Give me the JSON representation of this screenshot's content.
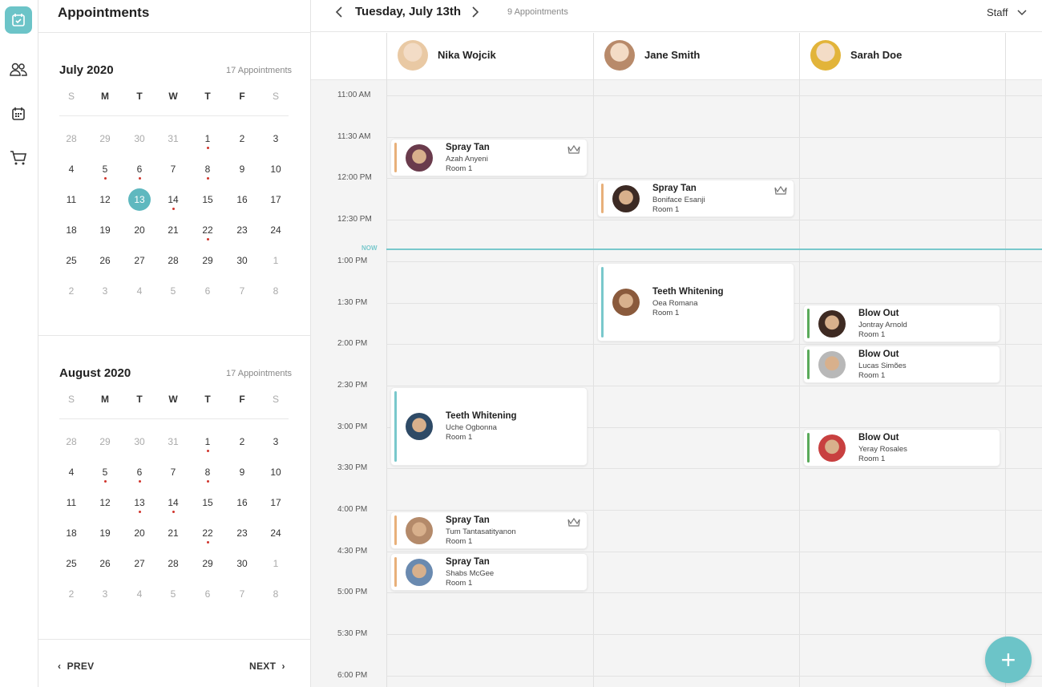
{
  "rail": {
    "items": [
      {
        "icon": "calendar-check-icon",
        "active": true
      },
      {
        "icon": "users-icon",
        "active": false
      },
      {
        "icon": "calendar-grid-icon",
        "active": false
      },
      {
        "icon": "cart-icon",
        "active": false
      }
    ]
  },
  "sidebar": {
    "title": "Appointments",
    "weekdays": [
      "S",
      "M",
      "T",
      "W",
      "T",
      "F",
      "S"
    ],
    "months": [
      {
        "title": "July 2020",
        "count": "17 Appointments",
        "weeks": [
          [
            {
              "d": "28",
              "dim": true
            },
            {
              "d": "29",
              "dim": true
            },
            {
              "d": "30",
              "dim": true
            },
            {
              "d": "31",
              "dim": true
            },
            {
              "d": "1",
              "dot": true
            },
            {
              "d": "2"
            },
            {
              "d": "3"
            }
          ],
          [
            {
              "d": "4"
            },
            {
              "d": "5",
              "dot": true
            },
            {
              "d": "6",
              "dot": true
            },
            {
              "d": "7"
            },
            {
              "d": "8",
              "dot": true
            },
            {
              "d": "9"
            },
            {
              "d": "10"
            }
          ],
          [
            {
              "d": "11"
            },
            {
              "d": "12"
            },
            {
              "d": "13",
              "sel": true
            },
            {
              "d": "14",
              "dot": true
            },
            {
              "d": "15"
            },
            {
              "d": "16"
            },
            {
              "d": "17"
            }
          ],
          [
            {
              "d": "18"
            },
            {
              "d": "19"
            },
            {
              "d": "20"
            },
            {
              "d": "21"
            },
            {
              "d": "22",
              "dot": true
            },
            {
              "d": "23"
            },
            {
              "d": "24"
            }
          ],
          [
            {
              "d": "25"
            },
            {
              "d": "26"
            },
            {
              "d": "27"
            },
            {
              "d": "28"
            },
            {
              "d": "29"
            },
            {
              "d": "30"
            },
            {
              "d": "1",
              "dim": true
            }
          ],
          [
            {
              "d": "2",
              "dim": true
            },
            {
              "d": "3",
              "dim": true
            },
            {
              "d": "4",
              "dim": true
            },
            {
              "d": "5",
              "dim": true
            },
            {
              "d": "6",
              "dim": true
            },
            {
              "d": "7",
              "dim": true
            },
            {
              "d": "8",
              "dim": true
            }
          ]
        ]
      },
      {
        "title": "August 2020",
        "count": "17 Appointments",
        "weeks": [
          [
            {
              "d": "28",
              "dim": true
            },
            {
              "d": "29",
              "dim": true
            },
            {
              "d": "30",
              "dim": true
            },
            {
              "d": "31",
              "dim": true
            },
            {
              "d": "1",
              "dot": true
            },
            {
              "d": "2"
            },
            {
              "d": "3"
            }
          ],
          [
            {
              "d": "4"
            },
            {
              "d": "5",
              "dot": true
            },
            {
              "d": "6",
              "dot": true
            },
            {
              "d": "7"
            },
            {
              "d": "8",
              "dot": true
            },
            {
              "d": "9"
            },
            {
              "d": "10"
            }
          ],
          [
            {
              "d": "11"
            },
            {
              "d": "12"
            },
            {
              "d": "13",
              "dot": true
            },
            {
              "d": "14",
              "dot": true
            },
            {
              "d": "15"
            },
            {
              "d": "16"
            },
            {
              "d": "17"
            }
          ],
          [
            {
              "d": "18"
            },
            {
              "d": "19"
            },
            {
              "d": "20"
            },
            {
              "d": "21"
            },
            {
              "d": "22",
              "dot": true
            },
            {
              "d": "23"
            },
            {
              "d": "24"
            }
          ],
          [
            {
              "d": "25"
            },
            {
              "d": "26"
            },
            {
              "d": "27"
            },
            {
              "d": "28"
            },
            {
              "d": "29"
            },
            {
              "d": "30"
            },
            {
              "d": "1",
              "dim": true
            }
          ],
          [
            {
              "d": "2",
              "dim": true
            },
            {
              "d": "3",
              "dim": true
            },
            {
              "d": "4",
              "dim": true
            },
            {
              "d": "5",
              "dim": true
            },
            {
              "d": "6",
              "dim": true
            },
            {
              "d": "7",
              "dim": true
            },
            {
              "d": "8",
              "dim": true
            }
          ]
        ]
      }
    ],
    "prev_label": "PREV",
    "next_label": "NEXT"
  },
  "header": {
    "date": "Tuesday, July 13th",
    "count": "9 Appointments",
    "staff_label": "Staff"
  },
  "staff": [
    {
      "name": "Nika Wojcik",
      "avatar_color": "#e9c9a4"
    },
    {
      "name": "Jane Smith",
      "avatar_color": "#b88a6a"
    },
    {
      "name": "Sarah Doe",
      "avatar_color": "#e2b43a"
    }
  ],
  "time_labels": [
    "11:00 AM",
    "11:30 AM",
    "12:00 PM",
    "12:30 PM",
    "1:00 PM",
    "1:30 PM",
    "2:00 PM",
    "2:30 PM",
    "3:00 PM",
    "3:30 PM",
    "4:00 PM",
    "4:30 PM",
    "5:00 PM",
    "5:30 PM",
    "6:00 PM"
  ],
  "now_label": "NOW",
  "appointments": [
    {
      "col": 0,
      "start": "11:30 AM",
      "service": "Spray Tan",
      "client": "Azah Anyeni",
      "room": "Room 1",
      "bar_color": "#e8b07a",
      "avatar_color": "#6a3b4c",
      "crown": true
    },
    {
      "col": 1,
      "start": "12:00 PM",
      "service": "Spray Tan",
      "client": "Boniface Esanji",
      "room": "Room 1",
      "bar_color": "#e8b07a",
      "avatar_color": "#3c2a24",
      "crown": true
    },
    {
      "col": 1,
      "start": "1:00 PM",
      "service": "Teeth Whitening",
      "client": "Oea Romana",
      "room": "Room 1",
      "bar_color": "#79c8cc",
      "avatar_color": "#8a5a3c",
      "crown": false
    },
    {
      "col": 2,
      "start": "1:30 PM",
      "service": "Blow Out",
      "client": "Jontray Arnold",
      "room": "Room 1",
      "bar_color": "#5aaa5a",
      "avatar_color": "#3e2a22",
      "crown": false
    },
    {
      "col": 2,
      "start": "2:00 PM",
      "service": "Blow Out",
      "client": "Lucas Simões",
      "room": "Room 1",
      "bar_color": "#5aaa5a",
      "avatar_color": "#b8b8b8",
      "crown": false
    },
    {
      "col": 0,
      "start": "2:30 PM",
      "service": "Teeth Whitening",
      "client": "Uche Ogbonna",
      "room": "Room 1",
      "bar_color": "#79c8cc",
      "avatar_color": "#2e4a66",
      "crown": false
    },
    {
      "col": 2,
      "start": "3:00 PM",
      "service": "Blow Out",
      "client": "Yeray Rosales",
      "room": "Room 1",
      "bar_color": "#5aaa5a",
      "avatar_color": "#c84040",
      "crown": false
    },
    {
      "col": 0,
      "start": "4:00 PM",
      "service": "Spray Tan",
      "client": "Tum Tantasatityanon",
      "room": "Room 1",
      "bar_color": "#e8b07a",
      "avatar_color": "#b48a6a",
      "crown": true
    },
    {
      "col": 0,
      "start": "4:30 PM",
      "service": "Spray Tan",
      "client": "Shabs McGee",
      "room": "Room 1",
      "bar_color": "#e8b07a",
      "avatar_color": "#6a8ab0",
      "crown": false
    }
  ]
}
